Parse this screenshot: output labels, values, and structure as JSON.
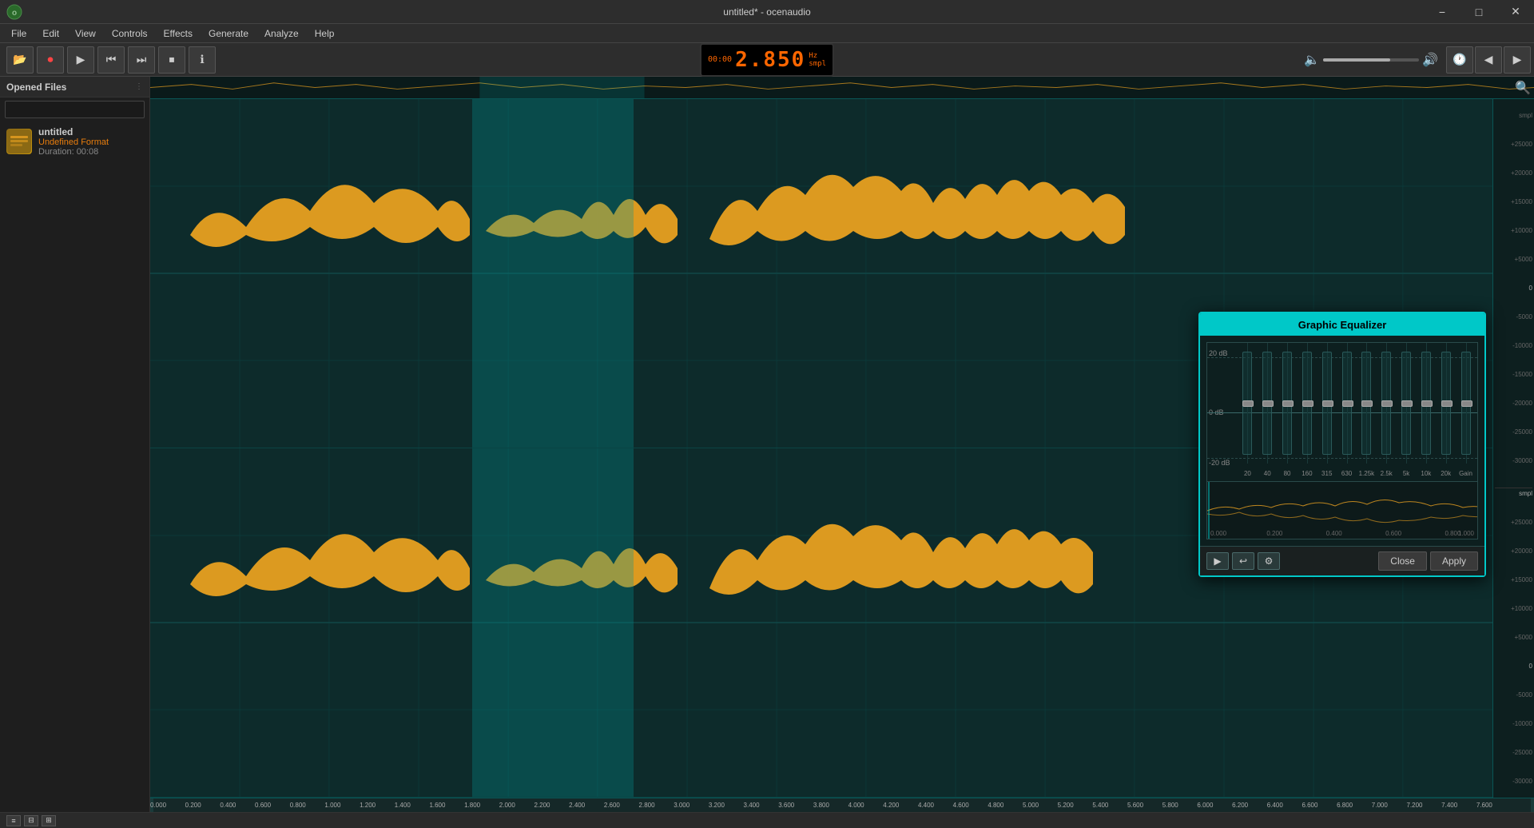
{
  "window": {
    "title": "untitled* - ocenaudio",
    "min_label": "−",
    "max_label": "□",
    "close_label": "✕"
  },
  "menubar": {
    "items": [
      "File",
      "Edit",
      "View",
      "Controls",
      "Effects",
      "Generate",
      "Analyze",
      "Help"
    ]
  },
  "toolbar": {
    "buttons": [
      {
        "name": "open",
        "icon": "📁"
      },
      {
        "name": "record",
        "icon": "⏺"
      },
      {
        "name": "play",
        "icon": "▶"
      },
      {
        "name": "rewind",
        "icon": "⏮"
      },
      {
        "name": "forward",
        "icon": "⏭"
      },
      {
        "name": "stop",
        "icon": "⏹"
      },
      {
        "name": "info",
        "icon": "ℹ"
      }
    ]
  },
  "transport": {
    "time_small": "00:00",
    "time_large": "2.850",
    "hz_label": "Hz",
    "freq_label": "smpl"
  },
  "volume": {
    "level": 70
  },
  "sidebar": {
    "title": "Opened Files",
    "search_placeholder": "",
    "files": [
      {
        "name": "untitled",
        "format": "Undefined Format",
        "duration": "Duration: 00:08"
      }
    ]
  },
  "right_scale": {
    "labels": [
      "+25000",
      "+20000",
      "+15000",
      "+10000",
      "+5000",
      "0",
      "-5000",
      "-10000",
      "-15000",
      "-20000",
      "-25000",
      "-30000",
      "smpl",
      "+25000",
      "+20000",
      "+15000",
      "+10000",
      "+5000",
      "0",
      "-5000",
      "-10000",
      "-25000",
      "-30000"
    ]
  },
  "bottom_timeline": {
    "labels": [
      "0.000",
      "0.200",
      "0.400",
      "0.600",
      "0.800",
      "1.000",
      "1.200",
      "1.400",
      "1.600",
      "1.800",
      "2.000",
      "2.200",
      "2.400",
      "2.600",
      "2.800",
      "3.000",
      "3.200",
      "3.400",
      "3.600",
      "3.800",
      "4.000",
      "4.200",
      "4.400",
      "4.600",
      "4.800",
      "5.000",
      "5.200",
      "5.400",
      "5.600",
      "5.800",
      "6.000",
      "6.200",
      "6.400",
      "6.600",
      "6.800",
      "7.000",
      "7.200",
      "7.400",
      "7.600"
    ]
  },
  "eq": {
    "title": "Graphic Equalizer",
    "db_labels": [
      "20 dB",
      "0 dB",
      "-20 dB"
    ],
    "freq_labels": [
      "20",
      "40",
      "80",
      "160",
      "315",
      "630",
      "1.25k",
      "2.5k",
      "5k",
      "10k",
      "20k",
      "Gain"
    ],
    "bands": 12,
    "close_label": "Close",
    "apply_label": "Apply",
    "mini_wave_label": "0.000",
    "mini_wave_end": "1.000"
  },
  "bottom_bar": {
    "buttons": [
      "≡",
      "⊟",
      "⊞"
    ]
  }
}
